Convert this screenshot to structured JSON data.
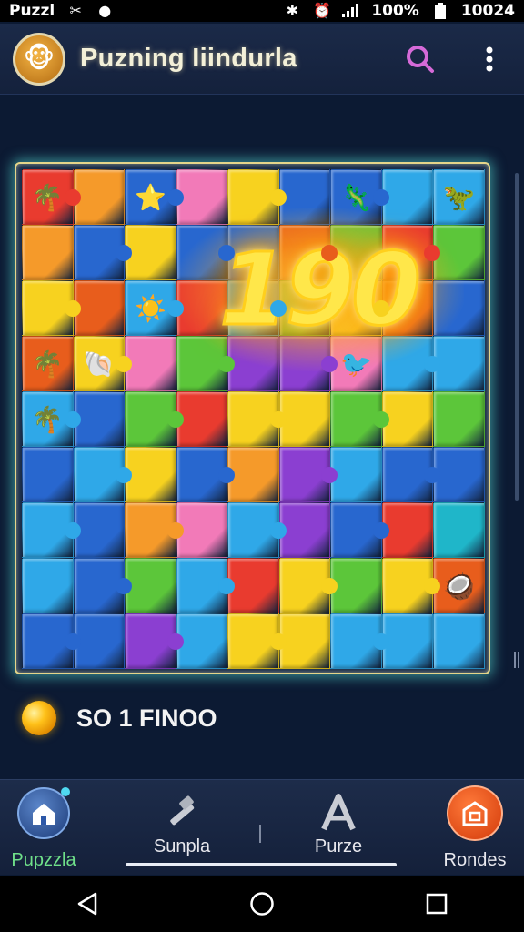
{
  "status_bar": {
    "app_name": "Puzzl",
    "battery": "100%",
    "time": "10024"
  },
  "app_bar": {
    "title": "Puzning Iiindurla"
  },
  "score": {
    "value": "190"
  },
  "coins": {
    "text": "SO 1 FINOO"
  },
  "nav": {
    "items": [
      {
        "label": "Pupzzla",
        "icon": "home-icon",
        "active": true
      },
      {
        "label": "Sunpla",
        "icon": "hammer-icon",
        "active": false
      },
      {
        "label": "Purze",
        "icon": "letter-a-icon",
        "active": false
      },
      {
        "label": "Rondes",
        "icon": "rounds-icon",
        "active": false
      }
    ]
  },
  "colors": {
    "background": "#0c1a33",
    "frame_border": "#e5d58a",
    "score_yellow": "#ffe74a",
    "active_nav": "#6fe08a"
  }
}
